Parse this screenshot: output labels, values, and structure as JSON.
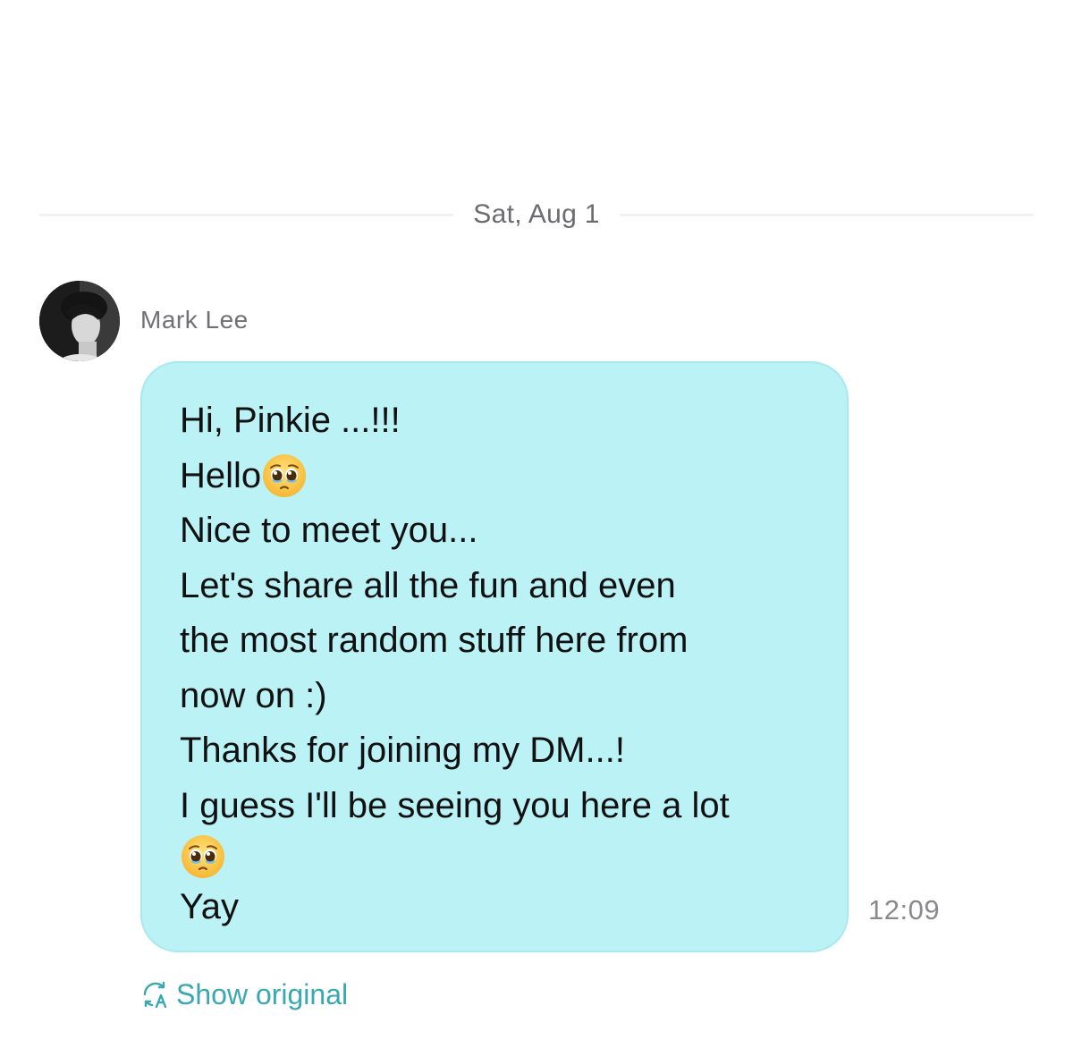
{
  "divider": {
    "date": "Sat, Aug 1"
  },
  "sender": {
    "name": "Mark Lee"
  },
  "message": {
    "lines": [
      {
        "text": "Hi, Pinkie ...!!!"
      },
      {
        "text": "Hello",
        "emoji": "pleading-face"
      },
      {
        "text": "Nice to meet you..."
      },
      {
        "text": "Let's share all the fun and even"
      },
      {
        "text": "the most random stuff here from"
      },
      {
        "text": "now on :)"
      },
      {
        "text": "Thanks for joining my DM...!"
      },
      {
        "text": "I guess I'll be seeing you here a lot"
      },
      {
        "text": "",
        "emoji": "pleading-face"
      },
      {
        "text": "Yay"
      }
    ],
    "time": "12:09",
    "bubble_color": "#baf2f6"
  },
  "translate": {
    "label": "Show original",
    "icon": "translate-icon",
    "color": "#3aa8b0"
  }
}
